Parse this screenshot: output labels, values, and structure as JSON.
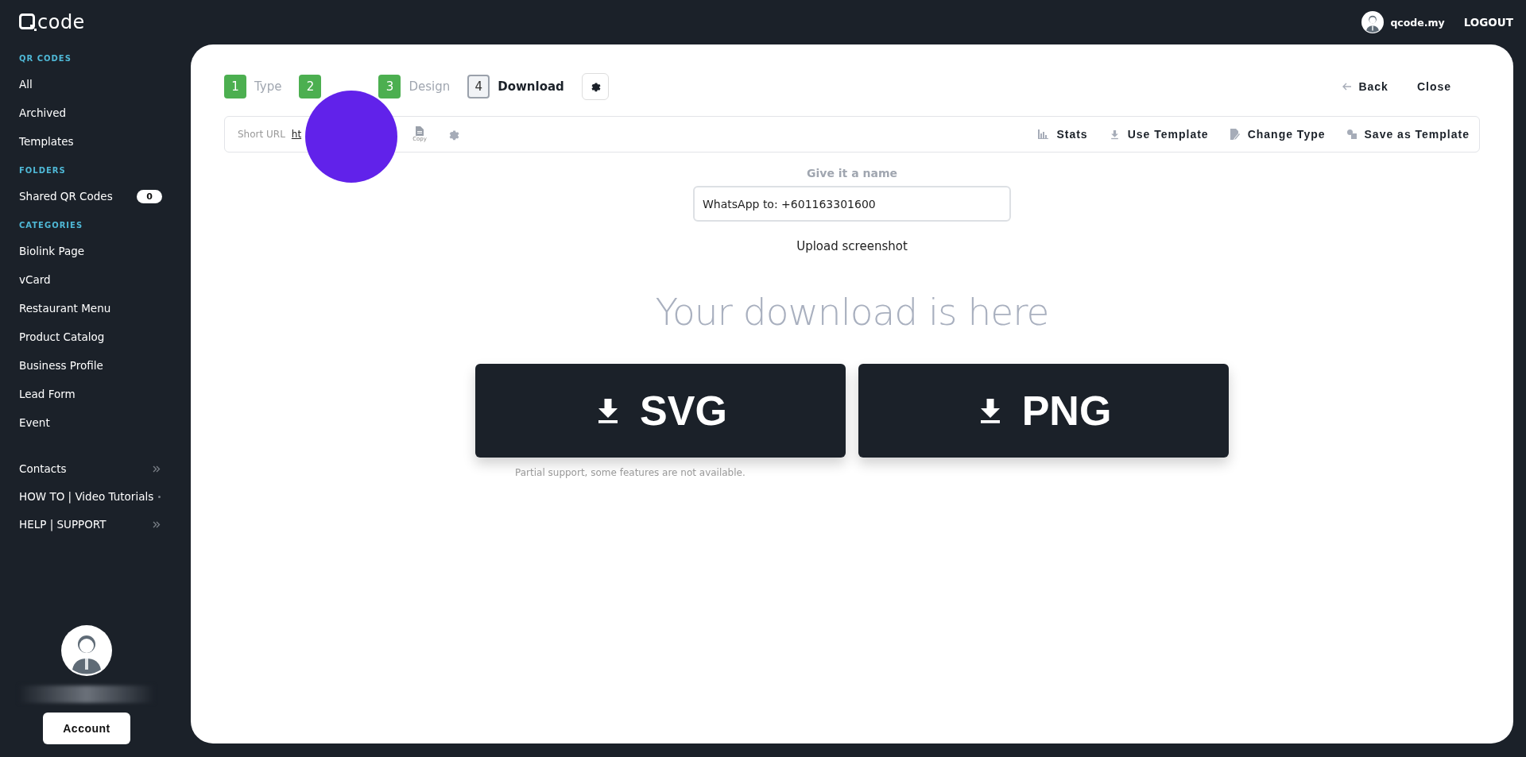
{
  "logo": {
    "text": "code"
  },
  "sidebar": {
    "sections": [
      {
        "heading": "QR CODES",
        "items": [
          {
            "label": "All"
          },
          {
            "label": "Archived"
          },
          {
            "label": "Templates"
          }
        ]
      },
      {
        "heading": "FOLDERS",
        "items": [
          {
            "label": "Shared QR Codes",
            "badge": "0"
          }
        ]
      },
      {
        "heading": "CATEGORIES",
        "items": [
          {
            "label": "Biolink Page"
          },
          {
            "label": "vCard"
          },
          {
            "label": "Restaurant Menu"
          },
          {
            "label": "Product Catalog"
          },
          {
            "label": "Business Profile"
          },
          {
            "label": "Lead Form"
          },
          {
            "label": "Event"
          }
        ]
      }
    ],
    "links": [
      {
        "label": "Contacts",
        "kind": "chevron"
      },
      {
        "label": "HOW TO | Video Tutorials",
        "kind": "dot"
      },
      {
        "label": "HELP | SUPPORT",
        "kind": "chevron"
      }
    ],
    "account_button": "Account"
  },
  "header": {
    "user": "qcode.my",
    "logout": "LOGOUT"
  },
  "steps": [
    {
      "number": "1",
      "label": "Type",
      "selected": false
    },
    {
      "number": "2",
      "selected": false
    },
    {
      "number": "3",
      "label": "Design",
      "selected": false
    },
    {
      "number": "4",
      "label": "Download",
      "selected": true
    }
  ],
  "nav": {
    "back": "Back",
    "close": "Close"
  },
  "toolbar": {
    "short_url_label": "Short URL",
    "short_url": "ht",
    "copy": "Copy",
    "actions": [
      {
        "kind": "stats",
        "label": "Stats"
      },
      {
        "kind": "download",
        "label": "Use Template"
      },
      {
        "kind": "edit",
        "label": "Change Type"
      },
      {
        "kind": "template",
        "label": "Save as Template"
      }
    ]
  },
  "name_field": {
    "label": "Give it a name",
    "value": "WhatsApp to: +601163301600"
  },
  "upload_link": "Upload screenshot",
  "headline": "Your download is here",
  "downloads": [
    {
      "label": "SVG"
    },
    {
      "label": "PNG"
    }
  ],
  "note": "Partial support, some features are not available."
}
